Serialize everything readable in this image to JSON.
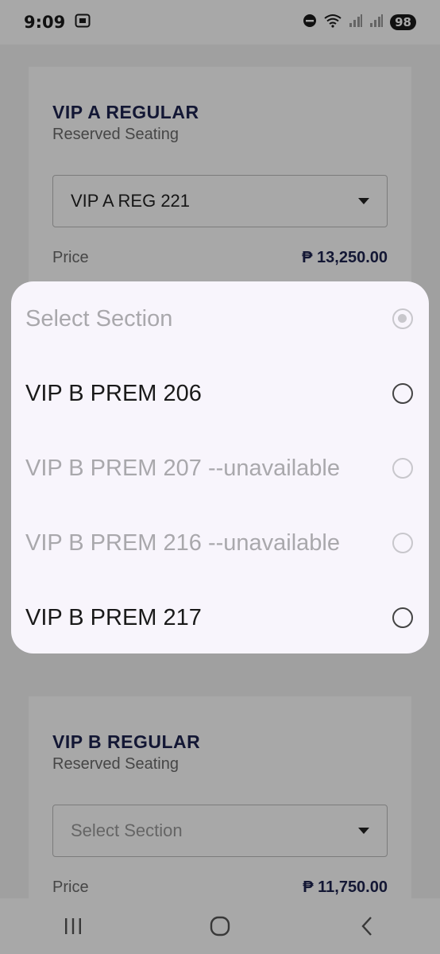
{
  "status_bar": {
    "time": "9:09",
    "battery": "98"
  },
  "cards": [
    {
      "title": "VIP A REGULAR",
      "subtitle": "Reserved Seating",
      "select_value": "VIP A REG 221",
      "price_label": "Price",
      "price_value": "₱ 13,250.00"
    },
    {
      "title": "VIP B REGULAR",
      "subtitle": "Reserved Seating",
      "select_value": "Select Section",
      "price_label": "Price",
      "price_value": "₱ 11,750.00"
    }
  ],
  "dialog": {
    "options": [
      {
        "label": "Select Section",
        "state": "selected-disabled"
      },
      {
        "label": "VIP B PREM 206",
        "state": "enabled"
      },
      {
        "label": "VIP B PREM 207 --unavailable",
        "state": "disabled"
      },
      {
        "label": "VIP B PREM 216 --unavailable",
        "state": "disabled"
      },
      {
        "label": "VIP B PREM 217",
        "state": "enabled"
      }
    ]
  },
  "colors": {
    "title": "#1d2350",
    "dialog_bg": "#f8f5fc",
    "scrim": "rgba(0,0,0,0.34)"
  },
  "icons": {
    "status_left": "screenshot-icon",
    "status_right": [
      "dnd-icon",
      "wifi-icon",
      "signal-icon",
      "signal-icon"
    ],
    "nav": [
      "recent-apps-icon",
      "home-icon",
      "back-icon"
    ]
  }
}
